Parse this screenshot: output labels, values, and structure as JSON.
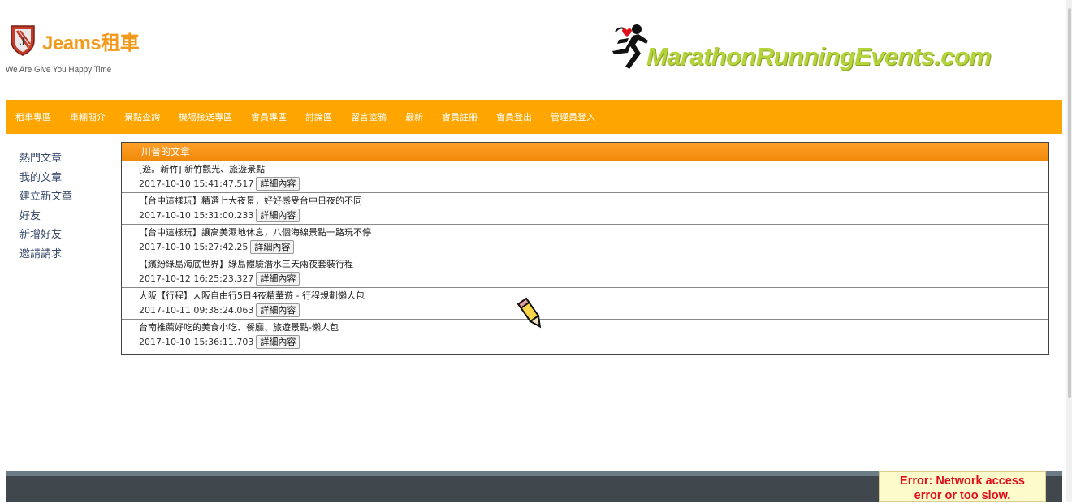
{
  "brand": {
    "name": "Jeams租車",
    "tagline": "We Are Give You Happy Time",
    "partner_logo": "MarathonRunningEvents.com",
    "accent_color": "#ffa500",
    "partner_color": "#b3d43a"
  },
  "nav": {
    "items": [
      {
        "label": "租車專區"
      },
      {
        "label": "車輛簡介"
      },
      {
        "label": "景點查詢"
      },
      {
        "label": "機場接送專區"
      },
      {
        "label": "會員專區"
      },
      {
        "label": "討論區"
      },
      {
        "label": "留言塗鴉"
      },
      {
        "label": "最新"
      },
      {
        "label": "會員註冊"
      },
      {
        "label": "會員登出"
      },
      {
        "label": "管理員登入"
      }
    ]
  },
  "sidebar": {
    "items": [
      {
        "label": "熱門文章"
      },
      {
        "label": "我的文章"
      },
      {
        "label": "建立新文章"
      },
      {
        "label": "好友"
      },
      {
        "label": "新增好友"
      },
      {
        "label": "邀請請求"
      }
    ]
  },
  "articles": {
    "header": "川普的文章",
    "button_label": "詳細內容",
    "items": [
      {
        "title": "[遊。新竹] 新竹觀光、旅遊景點",
        "date": "2017-10-10 15:41:47.517"
      },
      {
        "title": "【台中這樣玩】精選七大夜景，好好感受台中日夜的不同",
        "date": "2017-10-10 15:31:00.233"
      },
      {
        "title": "【台中這樣玩】讓高美濕地休息，八個海線景點一路玩不停",
        "date": "2017-10-10 15:27:42.25"
      },
      {
        "title": "【繽紛綠島海底世界】綠島體驗潛水三天兩夜套裝行程",
        "date": "2017-10-12 16:25:23.327"
      },
      {
        "title": "大阪【行程】大阪自由行5日4夜精華遊 - 行程規劃懶人包",
        "date": "2017-10-11 09:38:24.063"
      },
      {
        "title": "台南推薦好吃的美食小吃、餐廳、旅遊景點-懶人包",
        "date": "2017-10-10 15:36:11.703"
      }
    ]
  },
  "icons": {
    "logo": "shield-logo-icon",
    "runner": "runner-icon",
    "pencil": "pencil-icon"
  },
  "error": {
    "line1": "Error: Network access",
    "line2": "error or too slow.",
    "color": "#e0101b"
  }
}
